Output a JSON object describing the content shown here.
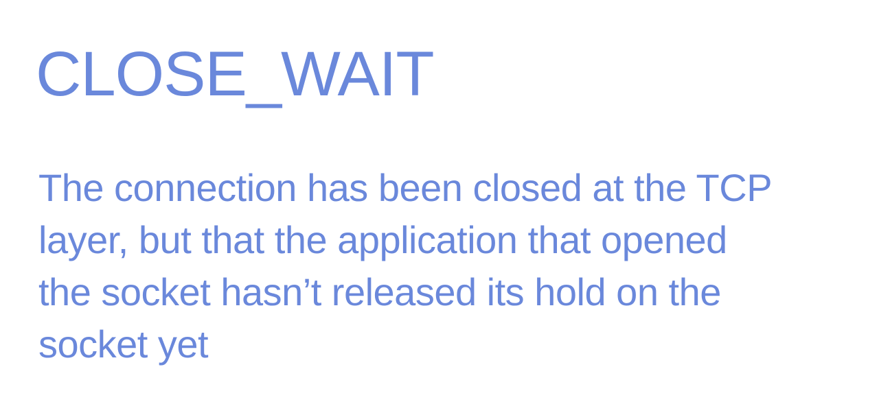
{
  "slide": {
    "title": "CLOSE_WAIT",
    "body_lines": [
      "The connection has been closed at the TCP",
      "layer, but that the application that opened",
      "the socket hasn’t released its hold on the",
      "socket yet"
    ]
  },
  "colors": {
    "text": "#6a88db",
    "background": "#ffffff"
  }
}
